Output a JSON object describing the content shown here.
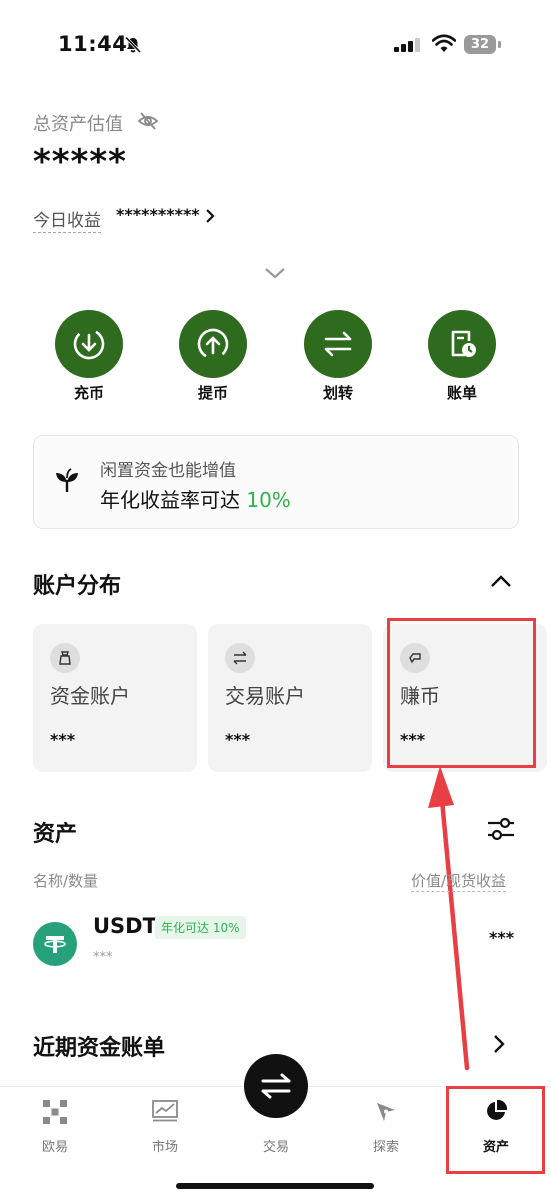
{
  "status_bar": {
    "time": "11:44",
    "battery": "32"
  },
  "header": {
    "total_label": "总资产估值",
    "total_value": "*****",
    "today_label": "今日收益",
    "today_value": "**********"
  },
  "actions": [
    {
      "label": "充币",
      "icon": "deposit-icon"
    },
    {
      "label": "提币",
      "icon": "withdraw-icon"
    },
    {
      "label": "划转",
      "icon": "transfer-icon"
    },
    {
      "label": "账单",
      "icon": "bill-icon"
    }
  ],
  "promo": {
    "line1": "闲置资金也能增值",
    "line2_prefix": "年化收益率可达 ",
    "line2_pct": "10%"
  },
  "distribution": {
    "title": "账户分布",
    "cards": [
      {
        "name": "资金账户",
        "value": "***",
        "icon": "wallet-bag-icon"
      },
      {
        "name": "交易账户",
        "value": "***",
        "icon": "swap-icon"
      },
      {
        "name": "赚币",
        "value": "***",
        "icon": "earn-icon"
      }
    ]
  },
  "assets": {
    "title": "资产",
    "col_left": "名称/数量",
    "col_right": "价值/现货收益",
    "rows": [
      {
        "name": "USDT",
        "badge": "年化可达 10%",
        "amount": "***",
        "value": "***"
      }
    ]
  },
  "recent": {
    "title": "近期资金账单"
  },
  "nav": {
    "items": [
      {
        "label": "欧易",
        "icon": "okx-logo-icon"
      },
      {
        "label": "市场",
        "icon": "market-chart-icon"
      },
      {
        "label": "交易",
        "icon": "trade-swap-icon"
      },
      {
        "label": "探索",
        "icon": "compass-icon"
      },
      {
        "label": "资产",
        "icon": "pie-chart-icon"
      }
    ]
  },
  "colors": {
    "accent_green": "#2e6b1f",
    "positive_green": "#2fb34a",
    "annotation_red": "#e83f45"
  }
}
